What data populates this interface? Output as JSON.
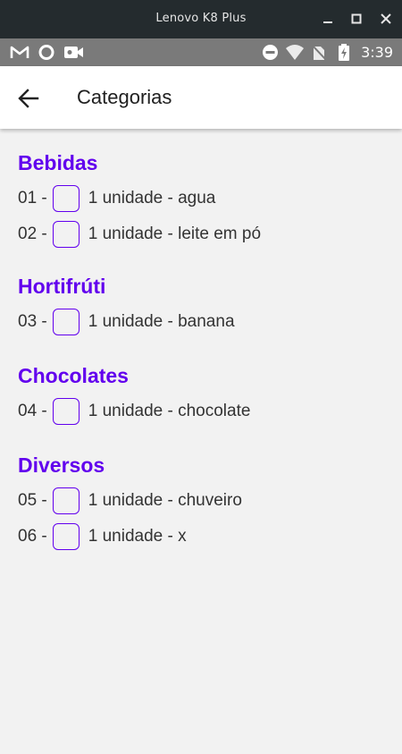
{
  "window": {
    "title": "Lenovo K8 Plus"
  },
  "status": {
    "time": "3:39"
  },
  "appbar": {
    "title": "Categorias"
  },
  "categories": [
    {
      "name": "Bebidas",
      "items": [
        {
          "number": "01 -",
          "text": "1 unidade - agua"
        },
        {
          "number": "02 -",
          "text": "1 unidade - leite em pó"
        }
      ]
    },
    {
      "name": "Hortifrúti",
      "items": [
        {
          "number": "03 -",
          "text": "1 unidade - banana"
        }
      ]
    },
    {
      "name": "Chocolates",
      "items": [
        {
          "number": "04 -",
          "text": "1 unidade - chocolate"
        }
      ]
    },
    {
      "name": "Diversos",
      "items": [
        {
          "number": "05 -",
          "text": "1 unidade - chuveiro"
        },
        {
          "number": "06 -",
          "text": "1 unidade - x"
        }
      ]
    }
  ],
  "colors": {
    "accent": "#6200ee",
    "window_bar": "#242b2e",
    "status_bar": "#7a7a7a",
    "background": "#f2f2f2"
  },
  "icons": [
    "gmail-icon",
    "circle-icon",
    "video-camera-icon",
    "do-not-disturb-icon",
    "wifi-icon",
    "no-sim-icon",
    "battery-charging-icon",
    "back-arrow-icon",
    "minimize-icon",
    "maximize-icon",
    "close-icon"
  ]
}
